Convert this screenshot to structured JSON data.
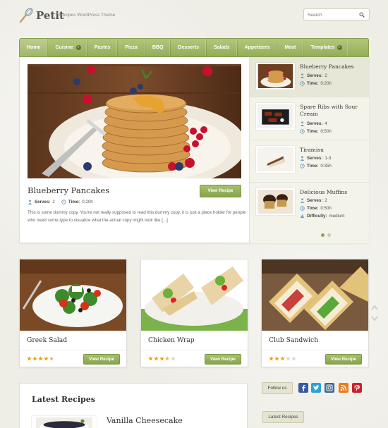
{
  "header": {
    "site_title": "Petit",
    "tagline": "Recipes WordPress Theme",
    "search_placeholder": "Search"
  },
  "nav": {
    "items": [
      {
        "label": "Home",
        "has_submenu": false
      },
      {
        "label": "Cuisine",
        "has_submenu": true
      },
      {
        "label": "Pastes",
        "has_submenu": false
      },
      {
        "label": "Pizza",
        "has_submenu": false
      },
      {
        "label": "BBQ",
        "has_submenu": false
      },
      {
        "label": "Desserts",
        "has_submenu": false
      },
      {
        "label": "Salads",
        "has_submenu": false
      },
      {
        "label": "Appetizers",
        "has_submenu": false
      },
      {
        "label": "Meat",
        "has_submenu": false
      },
      {
        "label": "Templates",
        "has_submenu": true
      }
    ]
  },
  "featured": {
    "title": "Blueberry Pancakes",
    "button": "View Recipe",
    "serves_label": "Serves:",
    "serves": "2",
    "time_label": "Time:",
    "time": "0:20h",
    "description": "This is some dummy copy. You're not really supposed to read this dummy copy, it is just a place holder for people who need some type to visualize what the actual copy might look like [...]"
  },
  "slider_list": [
    {
      "title": "Blueberry Pancakes",
      "serves_label": "Serves:",
      "serves": "2",
      "time_label": "Time:",
      "time": "0:20h"
    },
    {
      "title": "Spare Ribs with Sour Cream",
      "serves_label": "Serves:",
      "serves": "4",
      "time_label": "Time:",
      "time": "0:50h"
    },
    {
      "title": "Tiramisu",
      "serves_label": "Serves:",
      "serves": "1-3",
      "time_label": "Time:",
      "time": "0:35h"
    },
    {
      "title": "Delicious Muffins",
      "serves_label": "Serves:",
      "serves": "2",
      "time_label": "Time:",
      "time": "0:50h",
      "difficulty_label": "Difficulty:",
      "difficulty": "medium"
    }
  ],
  "cards": [
    {
      "title": "Greek Salad",
      "button": "View Recipe",
      "rating": 4.5
    },
    {
      "title": "Chicken Wrap",
      "button": "View Recipe",
      "rating": 3.5
    },
    {
      "title": "Club Sandwich",
      "button": "View Recipe",
      "rating": 3
    }
  ],
  "latest": {
    "heading": "Latest Recipes",
    "first_title": "Vanilla Cheesecake"
  },
  "sidebar": {
    "follow_label": "Follow us",
    "latest_label": "Latest Recipes",
    "social": [
      "facebook-icon",
      "twitter-icon",
      "instagram-icon",
      "rss-icon",
      "pinterest-icon"
    ]
  },
  "colors": {
    "accent": "#94ad58",
    "button": "#87a44b",
    "star": "#e8a317"
  }
}
